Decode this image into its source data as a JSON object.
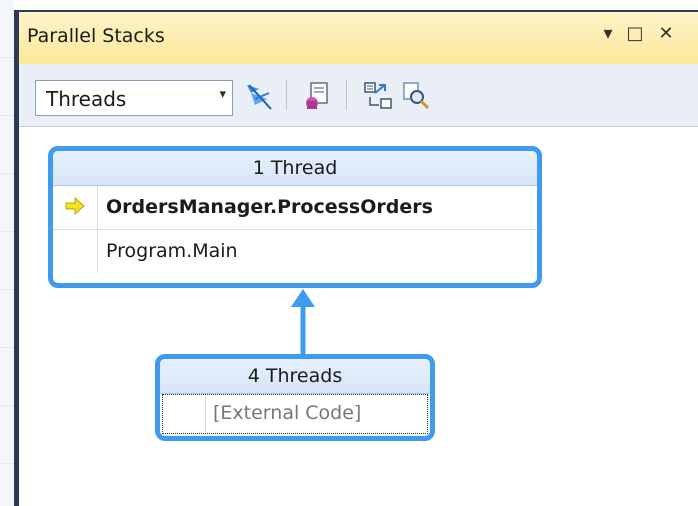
{
  "window": {
    "title": "Parallel Stacks",
    "controls": {
      "dropdown": "▾",
      "maximize": "□",
      "close": "✕"
    }
  },
  "toolbar": {
    "view_select": {
      "selected": "Threads",
      "arrow": "▾"
    },
    "icons": [
      "flag-threads-icon",
      "toggle-method-view-icon",
      "show-external-code-icon",
      "zoom-icon"
    ]
  },
  "graph": {
    "top_node": {
      "header": "1 Thread",
      "frames": [
        {
          "text": "OrdersManager.ProcessOrders",
          "current": true
        },
        {
          "text": "Program.Main",
          "current": false
        }
      ]
    },
    "bottom_node": {
      "header": "4 Threads",
      "frames": [
        {
          "text": "[External Code]"
        }
      ]
    }
  },
  "colors": {
    "node_border": "#3f9bf0",
    "title_bar": "#fce89a",
    "toolbar": "#e9eef7",
    "frame_border": "#2c3a55",
    "current_arrow": "#f4e21c"
  }
}
